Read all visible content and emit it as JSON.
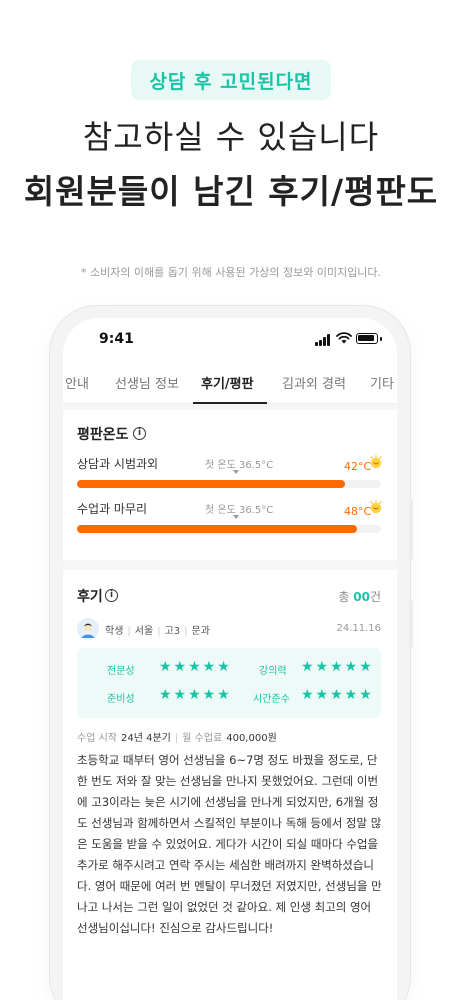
{
  "hero": {
    "badge": "상담 후 고민된다면",
    "title_line1": "참고하실 수 있습니다",
    "title_line2": "회원분들이 남긴 후기/평판도",
    "disclaimer": "* 소비자의 이해를 돕기 위해 사용된 가상의 정보와 이미지입니다."
  },
  "status_bar": {
    "time": "9:41"
  },
  "tabs": [
    {
      "label": "안내"
    },
    {
      "label": "선생님 정보"
    },
    {
      "label": "후기/평판"
    },
    {
      "label": "김과외 경력"
    },
    {
      "label": "기타"
    }
  ],
  "active_tab": "후기/평판",
  "reputation": {
    "title": "평판온도",
    "items": [
      {
        "label": "상담과 시범과외",
        "avg_text": "첫 온도 36.5°C",
        "value_text": "42°C",
        "fill_fraction": 0.88
      },
      {
        "label": "수업과 마무리",
        "avg_text": "첫 온도 36.5°C",
        "value_text": "48°C",
        "fill_fraction": 0.92
      }
    ]
  },
  "reviews": {
    "title": "후기",
    "count_prefix": "총 ",
    "count": "00",
    "count_suffix": "건",
    "item": {
      "role": "학생",
      "region": "서울",
      "grade": "고3",
      "track": "문과",
      "date": "24.11.16",
      "ratings": [
        {
          "label": "전문성",
          "stars": 5
        },
        {
          "label": "강의력",
          "stars": 5
        },
        {
          "label": "준비성",
          "stars": 5
        },
        {
          "label": "시간준수",
          "stars": 5
        }
      ],
      "start_label": "수업 시작",
      "start_value": "24년 4분기",
      "fee_label": "월 수업료",
      "fee_value": "400,000원",
      "body": "초등학교 때부터 영어 선생님을 6~7명 정도 바꿨을 정도로, 단 한 번도 저와 잘 맞는 선생님을 만나지 못했었어요. 그런데 이번에 고3이라는 늦은 시기에 선생님을 만나게 되었지만, 6개월 정도 선생님과 함께하면서 스킬적인 부분이나 독해 등에서 정말 많은 도움을 받을 수 있었어요. 게다가 시간이 되실 때마다 수업을 추가로 해주시려고 연락 주시는 세심한 배려까지 완벽하셨습니다. 영어 때문에 여러 번 멘탈이 무너졌던 저였지만, 선생님을 만나고 나서는 그런 일이 없었던 것 같아요. 제 인생 최고의 영어 선생님이십니다! 진심으로 감사드립니다!"
    }
  },
  "colors": {
    "accent": "#19c3a6",
    "temperature": "#ff6a00",
    "badge_bg": "#e8f8f5"
  },
  "icons": [
    "signal-icon",
    "wifi-icon",
    "battery-icon",
    "info-icon",
    "smile-face-icon",
    "student-avatar-icon",
    "star-icon"
  ]
}
